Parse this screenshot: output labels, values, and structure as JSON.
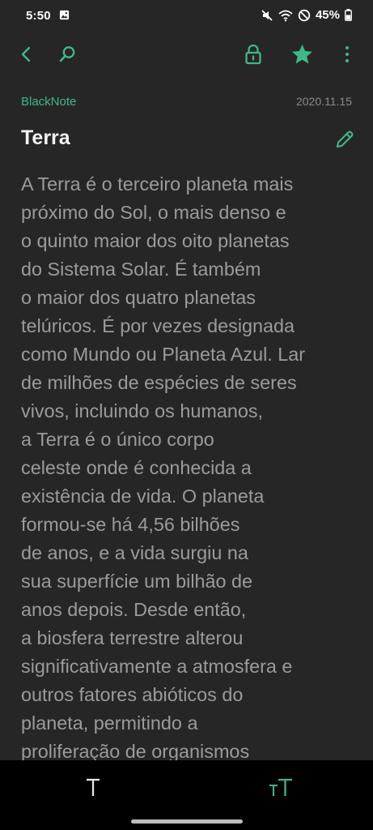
{
  "status_bar": {
    "time": "5:50",
    "battery": "45%"
  },
  "toolbar": {
    "icons": [
      "back-icon",
      "search-icon",
      "lock-icon",
      "star-icon",
      "more-options-icon"
    ],
    "accent_color": "#3fb888"
  },
  "note": {
    "folder": "BlackNote",
    "date": "2020.11.15",
    "title": "Terra",
    "body_lines": [
      "A Terra é o terceiro planeta mais",
      "próximo do Sol, o mais denso e",
      "o quinto maior dos oito planetas",
      "do Sistema Solar. É também",
      "o maior dos quatro planetas",
      "telúricos. É por vezes designada",
      "como Mundo ou Planeta Azul. Lar",
      "de milhões de espécies de seres",
      "vivos, incluindo os humanos,",
      "a Terra é o único corpo",
      "celeste onde é conhecida a",
      "existência de vida. O planeta",
      "formou-se há 4,56 bilhões",
      "de anos, e a vida surgiu na",
      "sua superfície um bilhão de",
      "anos depois. Desde então,",
      "a biosfera terrestre alterou",
      "significativamente a atmosfera e",
      "outros fatores abióticos do",
      "planeta, permitindo a",
      "proliferação de organismos"
    ]
  },
  "bottom_bar": {
    "icons": [
      "text-format-icon",
      "text-size-icon"
    ]
  }
}
